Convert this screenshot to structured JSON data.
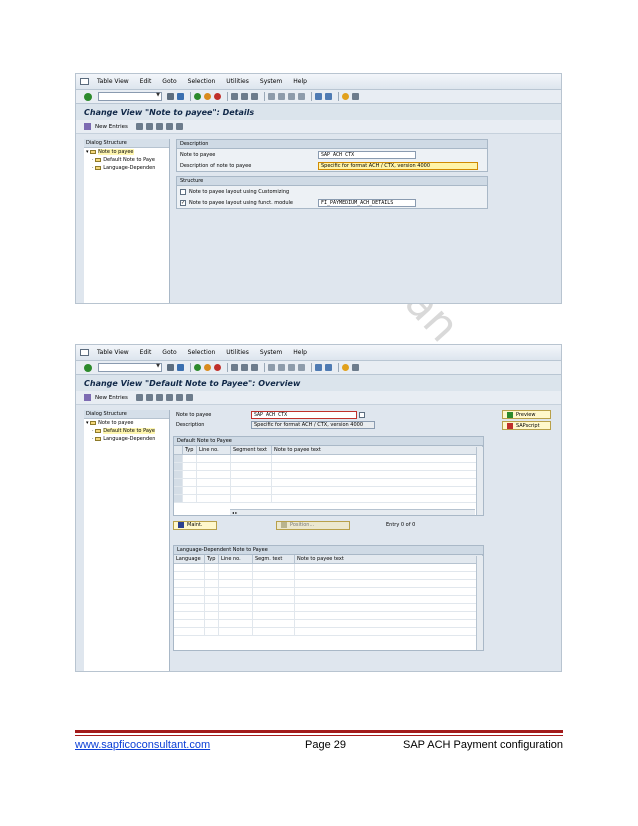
{
  "menu": {
    "items": [
      "Table View",
      "Edit",
      "Goto",
      "Selection",
      "Utilities",
      "System",
      "Help"
    ]
  },
  "screen1": {
    "title": "Change View \"Note to payee\": Details",
    "app_toolbar": {
      "new_entries": "New Entries"
    },
    "dialog_structure": {
      "header": "Dialog Structure",
      "nodes": [
        "Note to payee",
        "Default Note to Paye",
        "Language-Dependen"
      ]
    },
    "description_group": {
      "header": "Description",
      "rows": [
        {
          "label": "Note to payee",
          "value": "SAP ACH CTX"
        },
        {
          "label": "Description of note to payee",
          "value": "Specific for format ACH / CTX, version 4000"
        }
      ]
    },
    "structure_group": {
      "header": "Structure",
      "options": [
        {
          "label": "Note to payee layout using Customizing",
          "checked": false
        },
        {
          "label": "Note to payee layout using funct. module",
          "checked": true,
          "value": "FI_PAYMEDIUM_ACH_DETAILS"
        }
      ]
    }
  },
  "screen2": {
    "title": "Change View \"Default Note to Payee\": Overview",
    "app_toolbar": {
      "new_entries": "New Entries"
    },
    "dialog_structure": {
      "header": "Dialog Structure",
      "nodes": [
        "Note to payee",
        "Default Note to Paye",
        "Language-Dependen"
      ]
    },
    "header_fields": [
      {
        "label": "Note to payee",
        "value": "SAP ACH CTX"
      },
      {
        "label": "Description",
        "value": "Specific for format ACH / CTX, version 4000"
      }
    ],
    "buttons": {
      "preview": "Preview",
      "sapscript": "SAPscript",
      "maint": "Maint.",
      "position": "Position..."
    },
    "default_table": {
      "header": "Default Note to Payee",
      "columns": [
        "Typ",
        "Line no.",
        "Segment text",
        "Note to payee text"
      ]
    },
    "entry_count": "Entry 0 of 0",
    "lang_table": {
      "header": "Language-Dependent Note to Payee",
      "columns": [
        "Language",
        "Typ",
        "Line no.",
        "Segm. text",
        "Note to payee text"
      ]
    }
  },
  "footer": {
    "url": "www.sapficoconsultant.com",
    "page": "Page 29",
    "title": "SAP ACH Payment configuration"
  },
  "colors": {
    "footer_rule": "#a31a1a",
    "link": "#0b3fd6",
    "sap_title": "#102848"
  },
  "watermark": "ltan"
}
